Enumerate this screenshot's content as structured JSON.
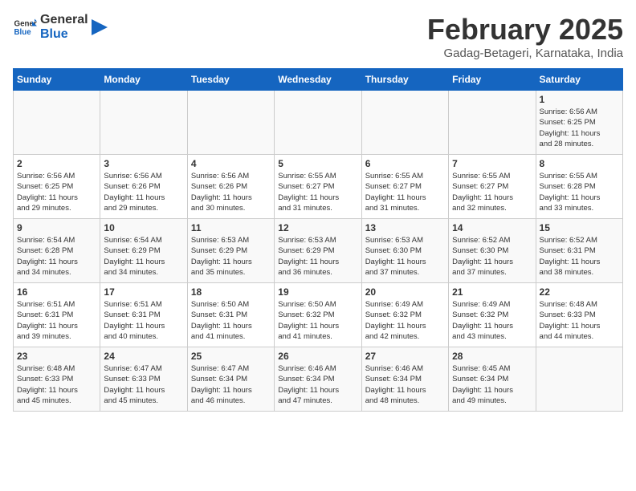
{
  "header": {
    "logo_general": "General",
    "logo_blue": "Blue",
    "month_title": "February 2025",
    "subtitle": "Gadag-Betageri, Karnataka, India"
  },
  "days_of_week": [
    "Sunday",
    "Monday",
    "Tuesday",
    "Wednesday",
    "Thursday",
    "Friday",
    "Saturday"
  ],
  "weeks": [
    [
      {
        "day": "",
        "info": ""
      },
      {
        "day": "",
        "info": ""
      },
      {
        "day": "",
        "info": ""
      },
      {
        "day": "",
        "info": ""
      },
      {
        "day": "",
        "info": ""
      },
      {
        "day": "",
        "info": ""
      },
      {
        "day": "1",
        "info": "Sunrise: 6:56 AM\nSunset: 6:25 PM\nDaylight: 11 hours\nand 28 minutes."
      }
    ],
    [
      {
        "day": "2",
        "info": "Sunrise: 6:56 AM\nSunset: 6:25 PM\nDaylight: 11 hours\nand 29 minutes."
      },
      {
        "day": "3",
        "info": "Sunrise: 6:56 AM\nSunset: 6:26 PM\nDaylight: 11 hours\nand 29 minutes."
      },
      {
        "day": "4",
        "info": "Sunrise: 6:56 AM\nSunset: 6:26 PM\nDaylight: 11 hours\nand 30 minutes."
      },
      {
        "day": "5",
        "info": "Sunrise: 6:55 AM\nSunset: 6:27 PM\nDaylight: 11 hours\nand 31 minutes."
      },
      {
        "day": "6",
        "info": "Sunrise: 6:55 AM\nSunset: 6:27 PM\nDaylight: 11 hours\nand 31 minutes."
      },
      {
        "day": "7",
        "info": "Sunrise: 6:55 AM\nSunset: 6:27 PM\nDaylight: 11 hours\nand 32 minutes."
      },
      {
        "day": "8",
        "info": "Sunrise: 6:55 AM\nSunset: 6:28 PM\nDaylight: 11 hours\nand 33 minutes."
      }
    ],
    [
      {
        "day": "9",
        "info": "Sunrise: 6:54 AM\nSunset: 6:28 PM\nDaylight: 11 hours\nand 34 minutes."
      },
      {
        "day": "10",
        "info": "Sunrise: 6:54 AM\nSunset: 6:29 PM\nDaylight: 11 hours\nand 34 minutes."
      },
      {
        "day": "11",
        "info": "Sunrise: 6:53 AM\nSunset: 6:29 PM\nDaylight: 11 hours\nand 35 minutes."
      },
      {
        "day": "12",
        "info": "Sunrise: 6:53 AM\nSunset: 6:29 PM\nDaylight: 11 hours\nand 36 minutes."
      },
      {
        "day": "13",
        "info": "Sunrise: 6:53 AM\nSunset: 6:30 PM\nDaylight: 11 hours\nand 37 minutes."
      },
      {
        "day": "14",
        "info": "Sunrise: 6:52 AM\nSunset: 6:30 PM\nDaylight: 11 hours\nand 37 minutes."
      },
      {
        "day": "15",
        "info": "Sunrise: 6:52 AM\nSunset: 6:31 PM\nDaylight: 11 hours\nand 38 minutes."
      }
    ],
    [
      {
        "day": "16",
        "info": "Sunrise: 6:51 AM\nSunset: 6:31 PM\nDaylight: 11 hours\nand 39 minutes."
      },
      {
        "day": "17",
        "info": "Sunrise: 6:51 AM\nSunset: 6:31 PM\nDaylight: 11 hours\nand 40 minutes."
      },
      {
        "day": "18",
        "info": "Sunrise: 6:50 AM\nSunset: 6:31 PM\nDaylight: 11 hours\nand 41 minutes."
      },
      {
        "day": "19",
        "info": "Sunrise: 6:50 AM\nSunset: 6:32 PM\nDaylight: 11 hours\nand 41 minutes."
      },
      {
        "day": "20",
        "info": "Sunrise: 6:49 AM\nSunset: 6:32 PM\nDaylight: 11 hours\nand 42 minutes."
      },
      {
        "day": "21",
        "info": "Sunrise: 6:49 AM\nSunset: 6:32 PM\nDaylight: 11 hours\nand 43 minutes."
      },
      {
        "day": "22",
        "info": "Sunrise: 6:48 AM\nSunset: 6:33 PM\nDaylight: 11 hours\nand 44 minutes."
      }
    ],
    [
      {
        "day": "23",
        "info": "Sunrise: 6:48 AM\nSunset: 6:33 PM\nDaylight: 11 hours\nand 45 minutes."
      },
      {
        "day": "24",
        "info": "Sunrise: 6:47 AM\nSunset: 6:33 PM\nDaylight: 11 hours\nand 45 minutes."
      },
      {
        "day": "25",
        "info": "Sunrise: 6:47 AM\nSunset: 6:34 PM\nDaylight: 11 hours\nand 46 minutes."
      },
      {
        "day": "26",
        "info": "Sunrise: 6:46 AM\nSunset: 6:34 PM\nDaylight: 11 hours\nand 47 minutes."
      },
      {
        "day": "27",
        "info": "Sunrise: 6:46 AM\nSunset: 6:34 PM\nDaylight: 11 hours\nand 48 minutes."
      },
      {
        "day": "28",
        "info": "Sunrise: 6:45 AM\nSunset: 6:34 PM\nDaylight: 11 hours\nand 49 minutes."
      },
      {
        "day": "",
        "info": ""
      }
    ]
  ]
}
